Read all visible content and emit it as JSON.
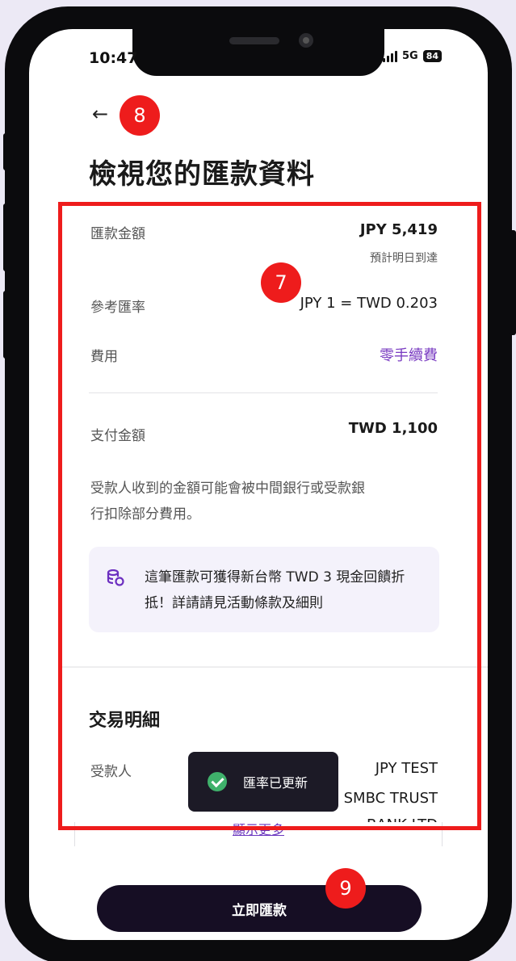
{
  "status_bar": {
    "time": "10:47",
    "network": "5G",
    "battery": "84"
  },
  "header": {
    "back_icon": "←",
    "title": "檢視您的匯款資料"
  },
  "summary": {
    "amount_label": "匯款金額",
    "amount_value": "JPY 5,419",
    "arrival_note": "預計明日到達",
    "rate_label": "參考匯率",
    "rate_value": "JPY 1 = TWD 0.203",
    "fee_label": "費用",
    "fee_value": "零手續費",
    "pay_label": "支付金額",
    "pay_value": "TWD 1,100",
    "disclaimer": "受款人收到的金額可能會被中間銀行或受款銀行扣除部分費用。"
  },
  "promo": {
    "icon": "coins-icon",
    "text": "這筆匯款可獲得新台幣 TWD 3 現金回饋折抵！詳請請見活動條款及細則"
  },
  "details": {
    "title": "交易明細",
    "recipient_label": "受款人",
    "recipient_name": "JPY TEST",
    "bank_line1": "SMBC TRUST",
    "bank_line2": "BANK LTD"
  },
  "toast": {
    "text": "匯率已更新"
  },
  "show_more": "顯示更多",
  "cta_label": "立即匯款",
  "annotations": {
    "box_badge": "7",
    "back_badge": "8",
    "cta_badge": "9"
  },
  "colors": {
    "accent": "#7a3cc2",
    "cta": "#160e24",
    "annotation": "#ee1c1c"
  }
}
